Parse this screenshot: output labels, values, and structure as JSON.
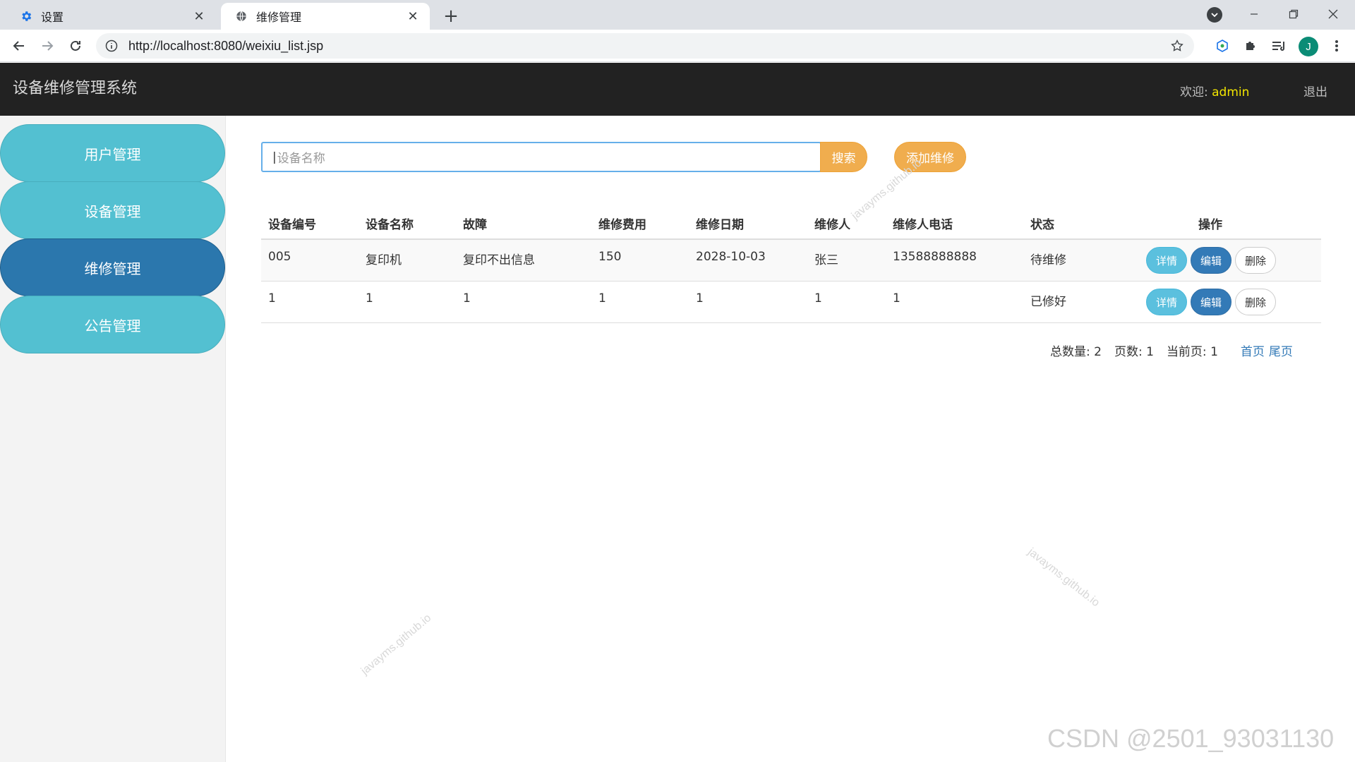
{
  "browser": {
    "tabs": [
      {
        "title": "设置",
        "active": false
      },
      {
        "title": "维修管理",
        "active": true
      }
    ],
    "url": "http://localhost:8080/weixiu_list.jsp",
    "profile_initial": "J"
  },
  "header": {
    "brand": "设备维修管理系统",
    "welcome_label": "欢迎:",
    "username": "admin",
    "logout": "退出"
  },
  "sidebar": {
    "items": [
      {
        "label": "用户管理",
        "active": false
      },
      {
        "label": "设备管理",
        "active": false
      },
      {
        "label": "维修管理",
        "active": true
      },
      {
        "label": "公告管理",
        "active": false
      }
    ]
  },
  "search": {
    "placeholder": "设备名称",
    "button": "搜索",
    "add_button": "添加维修"
  },
  "table": {
    "headers": [
      "设备编号",
      "设备名称",
      "故障",
      "维修费用",
      "维修日期",
      "维修人",
      "维修人电话",
      "状态",
      "操作"
    ],
    "rows": [
      {
        "cells": [
          "005",
          "复印机",
          "复印不出信息",
          "150",
          "2028-10-03",
          "张三",
          "13588888888",
          "待维修"
        ]
      },
      {
        "cells": [
          "1",
          "1",
          "1",
          "1",
          "1",
          "1",
          "1",
          "已修好"
        ]
      }
    ],
    "actions": {
      "detail": "详情",
      "edit": "编辑",
      "delete": "删除"
    }
  },
  "pager": {
    "total_label": "总数量:",
    "total": "2",
    "pages_label": "页数:",
    "pages": "1",
    "current_label": "当前页:",
    "current": "1",
    "first": "首页",
    "last": "尾页"
  },
  "watermarks": {
    "site": "javayms.github.io",
    "csdn": "CSDN @2501_93031130"
  },
  "colors": {
    "header_bg": "#222222",
    "sidebar_item": "#53c0d1",
    "sidebar_active": "#2b77ad",
    "warning": "#f0ad4e",
    "info": "#5bc0de",
    "primary": "#337ab7"
  }
}
